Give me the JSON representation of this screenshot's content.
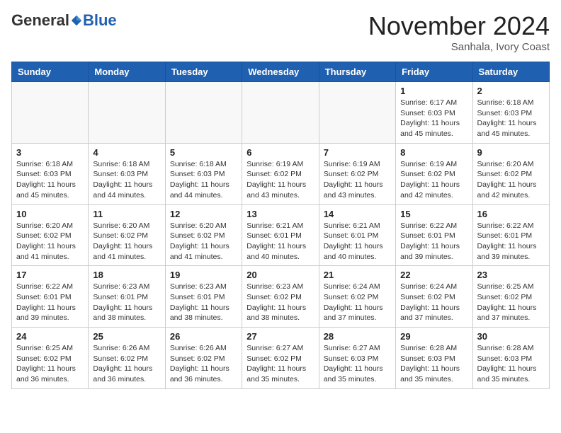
{
  "header": {
    "logo_general": "General",
    "logo_blue": "Blue",
    "month_title": "November 2024",
    "location": "Sanhala, Ivory Coast"
  },
  "calendar": {
    "days_of_week": [
      "Sunday",
      "Monday",
      "Tuesday",
      "Wednesday",
      "Thursday",
      "Friday",
      "Saturday"
    ],
    "weeks": [
      {
        "days": [
          {
            "date": "",
            "info": ""
          },
          {
            "date": "",
            "info": ""
          },
          {
            "date": "",
            "info": ""
          },
          {
            "date": "",
            "info": ""
          },
          {
            "date": "",
            "info": ""
          },
          {
            "date": "1",
            "info": "Sunrise: 6:17 AM\nSunset: 6:03 PM\nDaylight: 11 hours and 45 minutes."
          },
          {
            "date": "2",
            "info": "Sunrise: 6:18 AM\nSunset: 6:03 PM\nDaylight: 11 hours and 45 minutes."
          }
        ]
      },
      {
        "days": [
          {
            "date": "3",
            "info": "Sunrise: 6:18 AM\nSunset: 6:03 PM\nDaylight: 11 hours and 45 minutes."
          },
          {
            "date": "4",
            "info": "Sunrise: 6:18 AM\nSunset: 6:03 PM\nDaylight: 11 hours and 44 minutes."
          },
          {
            "date": "5",
            "info": "Sunrise: 6:18 AM\nSunset: 6:03 PM\nDaylight: 11 hours and 44 minutes."
          },
          {
            "date": "6",
            "info": "Sunrise: 6:19 AM\nSunset: 6:02 PM\nDaylight: 11 hours and 43 minutes."
          },
          {
            "date": "7",
            "info": "Sunrise: 6:19 AM\nSunset: 6:02 PM\nDaylight: 11 hours and 43 minutes."
          },
          {
            "date": "8",
            "info": "Sunrise: 6:19 AM\nSunset: 6:02 PM\nDaylight: 11 hours and 42 minutes."
          },
          {
            "date": "9",
            "info": "Sunrise: 6:20 AM\nSunset: 6:02 PM\nDaylight: 11 hours and 42 minutes."
          }
        ]
      },
      {
        "days": [
          {
            "date": "10",
            "info": "Sunrise: 6:20 AM\nSunset: 6:02 PM\nDaylight: 11 hours and 41 minutes."
          },
          {
            "date": "11",
            "info": "Sunrise: 6:20 AM\nSunset: 6:02 PM\nDaylight: 11 hours and 41 minutes."
          },
          {
            "date": "12",
            "info": "Sunrise: 6:20 AM\nSunset: 6:02 PM\nDaylight: 11 hours and 41 minutes."
          },
          {
            "date": "13",
            "info": "Sunrise: 6:21 AM\nSunset: 6:01 PM\nDaylight: 11 hours and 40 minutes."
          },
          {
            "date": "14",
            "info": "Sunrise: 6:21 AM\nSunset: 6:01 PM\nDaylight: 11 hours and 40 minutes."
          },
          {
            "date": "15",
            "info": "Sunrise: 6:22 AM\nSunset: 6:01 PM\nDaylight: 11 hours and 39 minutes."
          },
          {
            "date": "16",
            "info": "Sunrise: 6:22 AM\nSunset: 6:01 PM\nDaylight: 11 hours and 39 minutes."
          }
        ]
      },
      {
        "days": [
          {
            "date": "17",
            "info": "Sunrise: 6:22 AM\nSunset: 6:01 PM\nDaylight: 11 hours and 39 minutes."
          },
          {
            "date": "18",
            "info": "Sunrise: 6:23 AM\nSunset: 6:01 PM\nDaylight: 11 hours and 38 minutes."
          },
          {
            "date": "19",
            "info": "Sunrise: 6:23 AM\nSunset: 6:01 PM\nDaylight: 11 hours and 38 minutes."
          },
          {
            "date": "20",
            "info": "Sunrise: 6:23 AM\nSunset: 6:02 PM\nDaylight: 11 hours and 38 minutes."
          },
          {
            "date": "21",
            "info": "Sunrise: 6:24 AM\nSunset: 6:02 PM\nDaylight: 11 hours and 37 minutes."
          },
          {
            "date": "22",
            "info": "Sunrise: 6:24 AM\nSunset: 6:02 PM\nDaylight: 11 hours and 37 minutes."
          },
          {
            "date": "23",
            "info": "Sunrise: 6:25 AM\nSunset: 6:02 PM\nDaylight: 11 hours and 37 minutes."
          }
        ]
      },
      {
        "days": [
          {
            "date": "24",
            "info": "Sunrise: 6:25 AM\nSunset: 6:02 PM\nDaylight: 11 hours and 36 minutes."
          },
          {
            "date": "25",
            "info": "Sunrise: 6:26 AM\nSunset: 6:02 PM\nDaylight: 11 hours and 36 minutes."
          },
          {
            "date": "26",
            "info": "Sunrise: 6:26 AM\nSunset: 6:02 PM\nDaylight: 11 hours and 36 minutes."
          },
          {
            "date": "27",
            "info": "Sunrise: 6:27 AM\nSunset: 6:02 PM\nDaylight: 11 hours and 35 minutes."
          },
          {
            "date": "28",
            "info": "Sunrise: 6:27 AM\nSunset: 6:03 PM\nDaylight: 11 hours and 35 minutes."
          },
          {
            "date": "29",
            "info": "Sunrise: 6:28 AM\nSunset: 6:03 PM\nDaylight: 11 hours and 35 minutes."
          },
          {
            "date": "30",
            "info": "Sunrise: 6:28 AM\nSunset: 6:03 PM\nDaylight: 11 hours and 35 minutes."
          }
        ]
      }
    ]
  }
}
